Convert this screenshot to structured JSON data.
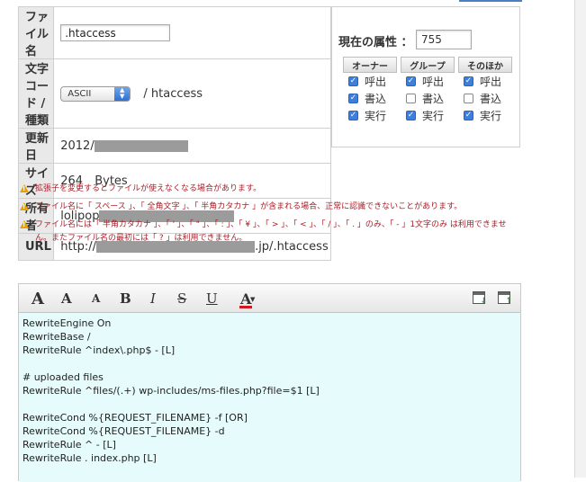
{
  "file_info": {
    "filename_label": "ファイル名",
    "filename_value": ".htaccess",
    "encoding_label": "文字コード / 種類",
    "encoding_select": "ASCII",
    "encoding_type": "/ htaccess",
    "updated_label": "更新日",
    "updated_value": "2012/",
    "size_label": "サイズ",
    "size_value": "264",
    "size_unit": "Bytes",
    "owner_label": "所有者",
    "owner_value": "lolipop",
    "url_label": "URL",
    "url_prefix": "http://",
    "url_suffix": ".jp/.htaccess"
  },
  "permissions": {
    "label": "現在の属性 ：",
    "value": "755",
    "columns": [
      {
        "header": "オーナー",
        "items": [
          {
            "label": "呼出",
            "checked": true
          },
          {
            "label": "書込",
            "checked": true
          },
          {
            "label": "実行",
            "checked": true
          }
        ]
      },
      {
        "header": "グループ",
        "items": [
          {
            "label": "呼出",
            "checked": true
          },
          {
            "label": "書込",
            "checked": false
          },
          {
            "label": "実行",
            "checked": true
          }
        ]
      },
      {
        "header": "そのほか",
        "items": [
          {
            "label": "呼出",
            "checked": true
          },
          {
            "label": "書込",
            "checked": false
          },
          {
            "label": "実行",
            "checked": true
          }
        ]
      }
    ]
  },
  "warnings": [
    "拡張子を変更するとファイルが使えなくなる場合があります。",
    "ファイル名に「 スペース 」、「 全角文字 」、「 半角カタカナ 」が含まれる場合、正常に認識できないことがあります。",
    "ファイル名には「 半角カタカナ 」、「 ' 」、「 \" 」、「 : 」、「 ¥ 」、「 > 」、「 < 」、「 / 」、「 . 」のみ、「 - 」1文字のみ は利用できません。またファイル名の最初には「 ? 」は利用できません。"
  ],
  "toolbar": {
    "font_large": "A",
    "font_medium": "A",
    "font_small": "A",
    "bold": "B",
    "italic": "I",
    "strike": "S",
    "underline": "U",
    "color": "A"
  },
  "editor": {
    "lines": [
      "RewriteEngine On",
      "RewriteBase /",
      "RewriteRule ^index\\.php$ - [L]",
      "",
      "# uploaded files",
      "RewriteRule ^files/(.+) wp-includes/ms-files.php?file=$1 [L]",
      "",
      "RewriteCond %{REQUEST_FILENAME} -f [OR]",
      "RewriteCond %{REQUEST_FILENAME} -d",
      "RewriteRule ^ - [L]",
      "RewriteRule . index.php [L]"
    ]
  },
  "colors": {
    "warning_text": "#a8202a",
    "editor_bg": "#e6fcfc",
    "checkbox_on": "#3d7fde",
    "label_bg": "#e9e9e9"
  }
}
